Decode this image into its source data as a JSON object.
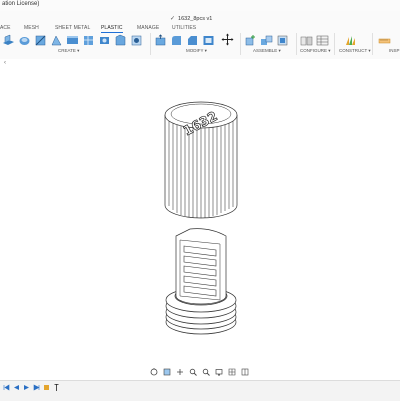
{
  "window": {
    "title": "ation License)"
  },
  "document": {
    "tab_label": "1632_8pcs v1"
  },
  "ribbon": {
    "tabs": [
      {
        "label": "ACE"
      },
      {
        "label": "MESH"
      },
      {
        "label": "SHEET METAL"
      },
      {
        "label": "PLASTIC"
      },
      {
        "label": "MANAGE"
      },
      {
        "label": "UTILITIES"
      }
    ],
    "groups": [
      {
        "label": "CREATE ▾"
      },
      {
        "label": "MODIFY ▾"
      },
      {
        "label": "ASSEMBLE ▾"
      },
      {
        "label": "CONFIGURE ▾"
      },
      {
        "label": "CONSTRUCT ▾"
      },
      {
        "label": "INSP"
      }
    ]
  },
  "viewport": {
    "engraving": "1632",
    "sidebar_toggle": "‹"
  },
  "colors": {
    "accent": "#1f6fd6",
    "toolbar_bg": "#fafafa",
    "model_stroke": "#333333"
  }
}
